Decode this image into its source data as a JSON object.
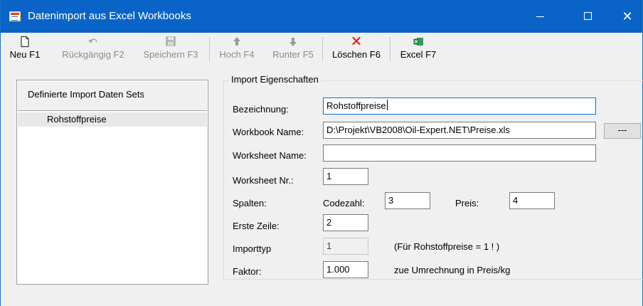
{
  "window": {
    "title": "Datenimport aus Excel Workbooks",
    "controls": {
      "minimize": "–",
      "maximize": "□",
      "close": "✕"
    }
  },
  "toolbar": {
    "new_label": "Neu F1",
    "undo_label": "Rückgängig F2",
    "save_label": "Speichern F3",
    "up_label": "Hoch F4",
    "down_label": "Runter F5",
    "delete_label": "Löschen F6",
    "excel_label": "Excel F7"
  },
  "dataset_list": {
    "header": "Definierte Import Daten Sets",
    "items": [
      "Rohstoffpreise"
    ]
  },
  "import_properties": {
    "title": "Import Eigenschaften",
    "bezeichnung_label": "Bezeichnung:",
    "bezeichnung_value": "Rohstoffpreise",
    "workbook_label": "Workbook Name:",
    "workbook_value": "D:\\Projekt\\VB2008\\Oil-Expert.NET\\Preise.xls",
    "browse_label": "---",
    "worksheet_name_label": "Worksheet Name:",
    "worksheet_name_value": "",
    "worksheet_nr_label": "Worksheet Nr.:",
    "worksheet_nr_value": "1",
    "spalten_label": "Spalten:",
    "codezahl_label": "Codezahl:",
    "codezahl_value": "3",
    "preis_label": "Preis:",
    "preis_value": "4",
    "erste_zeile_label": "Erste Zeile:",
    "erste_zeile_value": "2",
    "importtyp_label": "Importtyp",
    "importtyp_value": "1",
    "importtyp_hint": "(Für Rohstoffpreise = 1 ! )",
    "faktor_label": "Faktor:",
    "faktor_value": "1.000",
    "faktor_hint": "zue Umrechnung in Preis/kg"
  },
  "colors": {
    "titlebar": "#0a64c8",
    "delete_icon": "#e0201b",
    "excel_icon": "#1d7a45",
    "focus_border": "#0078d7"
  }
}
